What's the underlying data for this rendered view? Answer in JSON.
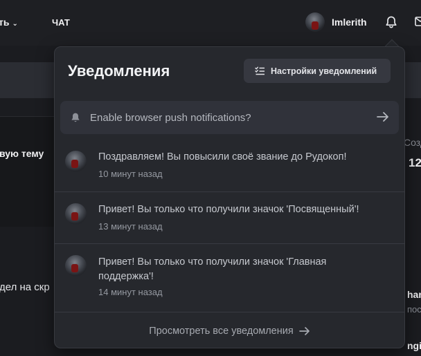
{
  "nav": {
    "left_item_label": "ть",
    "chat_label": "ЧАТ",
    "username": "Imlerith"
  },
  "background": {
    "left_text_1": "вую тему",
    "left_text_2": "дел на скр",
    "right_text_1": "Созд",
    "right_text_2": "12",
    "right_text_3": "han",
    "right_text_4": "пост",
    "right_text_5": "ngi"
  },
  "notifications_dropdown": {
    "title": "Уведомления",
    "settings_label": "Настройки уведомлений",
    "push_prompt": "Enable browser push notifications?",
    "items": [
      {
        "text": "Поздравляем! Вы повысили своё звание до Рудокоп!",
        "time": "10 минут назад"
      },
      {
        "text": "Привет! Вы только что получили значок 'Посвященный'!",
        "time": "13 минут назад"
      },
      {
        "text": "Привет! Вы только что получили значок 'Главная поддержка'!",
        "time": "14 минут назад"
      }
    ],
    "view_all_label": "Просмотреть все уведомления"
  },
  "icons": {
    "bell": "bell-icon",
    "mail": "mail-icon",
    "chevron": "chevron-down-icon",
    "settings": "list-settings-icon",
    "arrow": "arrow-right-icon"
  }
}
